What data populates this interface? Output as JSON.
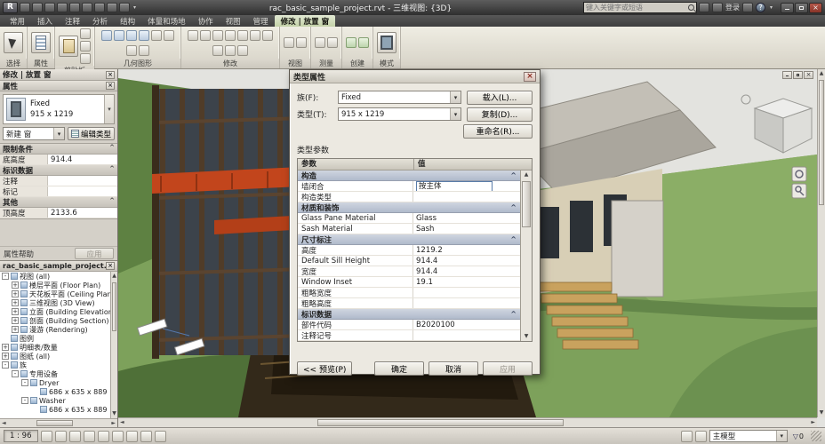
{
  "titlebar": {
    "app_label": "R",
    "title": "rac_basic_sample_project.rvt - 三维视图: {3D}",
    "search_placeholder": "键入关键字或短语",
    "sign_in_label": "登录"
  },
  "icons": {
    "close_glyph": "×",
    "dropdown_glyph": "▾",
    "collapse_glyph": "^",
    "up_glyph": "▲",
    "down_glyph": "▼",
    "left_glyph": "◄",
    "right_glyph": "►",
    "help_glyph": "?",
    "funnel_glyph": "▽"
  },
  "ribbon": {
    "tabs": [
      {
        "label": "常用"
      },
      {
        "label": "插入"
      },
      {
        "label": "注释"
      },
      {
        "label": "分析"
      },
      {
        "label": "结构"
      },
      {
        "label": "体量和场地"
      },
      {
        "label": "协作"
      },
      {
        "label": "视图"
      },
      {
        "label": "管理"
      },
      {
        "label": "修改 | 放置 窗",
        "active": true
      }
    ],
    "panels": {
      "select": "选择",
      "properties": "属性",
      "clipboard": "剪贴板",
      "geometry": "几何图形",
      "modify": "修改",
      "view": "视图",
      "measure": "测量",
      "create": "创建",
      "mode": "模式"
    }
  },
  "options_bar": {
    "label": "修改 | 放置 窗"
  },
  "properties_palette": {
    "title": "属性",
    "type_name": "Fixed",
    "type_size": "915 x 1219",
    "selector": "新建 窗",
    "edit_type_label": "编辑类型",
    "rows": [
      {
        "kind": "group",
        "label": "限制条件",
        "value": ""
      },
      {
        "kind": "row",
        "label": "底高度",
        "value": "914.4"
      },
      {
        "kind": "group",
        "label": "标识数据",
        "value": ""
      },
      {
        "kind": "row",
        "label": "注释",
        "value": ""
      },
      {
        "kind": "row",
        "label": "标记",
        "value": ""
      },
      {
        "kind": "group",
        "label": "其他",
        "value": ""
      },
      {
        "kind": "row",
        "label": "顶高度",
        "value": "2133.6"
      }
    ],
    "help_label": "属性帮助",
    "apply_label": "应用"
  },
  "project_browser": {
    "title": "rac_basic_sample_project.rvt - ...",
    "items": [
      {
        "label": "视图 (all)",
        "depth": 0,
        "exp": "-"
      },
      {
        "label": "楼层平面 (Floor Plan)",
        "depth": 1,
        "exp": "+"
      },
      {
        "label": "天花板平面 (Ceiling Plan)",
        "depth": 1,
        "exp": "+"
      },
      {
        "label": "三维视图 (3D View)",
        "depth": 1,
        "exp": "+"
      },
      {
        "label": "立面 (Building Elevation)",
        "depth": 1,
        "exp": "+"
      },
      {
        "label": "剖面 (Building Section)",
        "depth": 1,
        "exp": "+"
      },
      {
        "label": "漫游 (Rendering)",
        "depth": 1,
        "exp": "+"
      },
      {
        "label": "图例",
        "depth": 0,
        "exp": ""
      },
      {
        "label": "明细表/数量",
        "depth": 0,
        "exp": "+"
      },
      {
        "label": "图纸 (all)",
        "depth": 0,
        "exp": "+"
      },
      {
        "label": "族",
        "depth": 0,
        "exp": "-"
      },
      {
        "label": "专用设备",
        "depth": 1,
        "exp": "-"
      },
      {
        "label": "Dryer",
        "depth": 2,
        "exp": "-"
      },
      {
        "label": "686 x 635 x 889",
        "depth": 3,
        "exp": ""
      },
      {
        "label": "Washer",
        "depth": 2,
        "exp": "-"
      },
      {
        "label": "686 x 635 x 889",
        "depth": 3,
        "exp": ""
      }
    ]
  },
  "type_dialog": {
    "title": "类型属性",
    "family_label": "族(F):",
    "family_value": "Fixed",
    "type_label": "类型(T):",
    "type_value": "915 x 1219",
    "load_button": "载入(L)...",
    "duplicate_button": "复制(D)...",
    "rename_button": "重命名(R)...",
    "type_params_label": "类型参数",
    "columns": {
      "param": "参数",
      "value": "值"
    },
    "rows": [
      {
        "kind": "group",
        "label": "构造",
        "value": ""
      },
      {
        "kind": "edit",
        "label": "墙闭合",
        "value": "按主体"
      },
      {
        "kind": "row",
        "label": "构造类型",
        "value": ""
      },
      {
        "kind": "group",
        "label": "材质和装饰",
        "value": ""
      },
      {
        "kind": "row",
        "label": "Glass Pane Material",
        "value": "Glass"
      },
      {
        "kind": "row",
        "label": "Sash Material",
        "value": "Sash"
      },
      {
        "kind": "group",
        "label": "尺寸标注",
        "value": ""
      },
      {
        "kind": "row",
        "label": "高度",
        "value": "1219.2"
      },
      {
        "kind": "row",
        "label": "Default Sill Height",
        "value": "914.4"
      },
      {
        "kind": "row",
        "label": "宽度",
        "value": "914.4"
      },
      {
        "kind": "row",
        "label": "Window Inset",
        "value": "19.1"
      },
      {
        "kind": "row",
        "label": "粗略宽度",
        "value": ""
      },
      {
        "kind": "row",
        "label": "粗略高度",
        "value": ""
      },
      {
        "kind": "group",
        "label": "标识数据",
        "value": ""
      },
      {
        "kind": "row",
        "label": "部件代码",
        "value": "B2020100"
      },
      {
        "kind": "row",
        "label": "注释记号",
        "value": ""
      }
    ],
    "preview_button": "<< 预览(P)",
    "ok_button": "确定",
    "cancel_button": "取消",
    "apply_button": "应用"
  },
  "status_bar": {
    "scale": "1 : 96",
    "design_option": "主模型",
    "filter_count": "0"
  },
  "colors": {
    "contextual_tab_green": "#c3d1a7",
    "terrain_green": "#7da15b",
    "canopy_red": "#c2451c",
    "glass_dark": "#3c434b"
  }
}
